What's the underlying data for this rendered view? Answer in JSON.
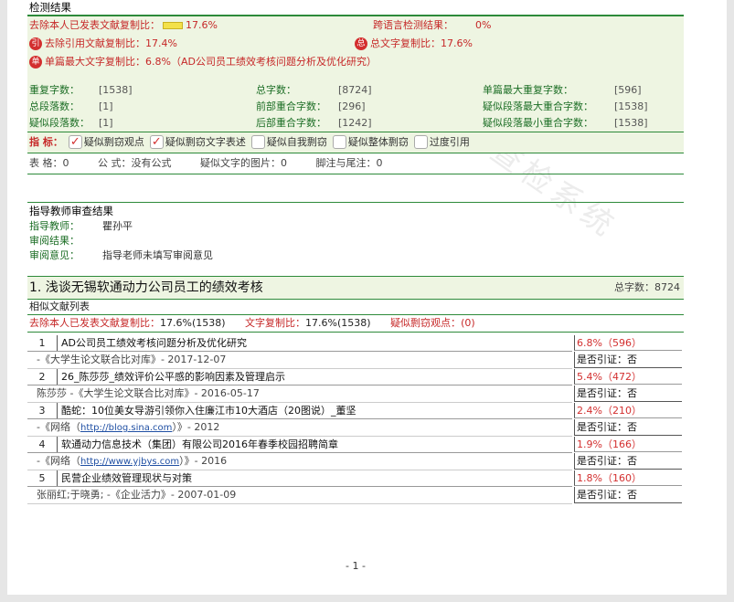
{
  "detection": {
    "section_title": "检测结果",
    "excl_label": "去除本人已发表文献复制比：",
    "excl_value": "17.6%",
    "cross_label": "跨语言检测结果：",
    "cross_value": "0%",
    "cite_badge": "引",
    "cite_label": "去除引用文献复制比：",
    "cite_value": "17.4%",
    "total_badge": "总",
    "total_label": "总文字复制比：",
    "total_value": "17.6%",
    "single_badge": "单",
    "single_label": "单篇最大文字复制比：",
    "single_value": "6.8%（AD公司员工绩效考核问题分析及优化研究）"
  },
  "stats": [
    [
      {
        "label": "重复字数：",
        "value": "[1538]"
      },
      {
        "label": "总字数：",
        "value": "[8724]"
      },
      {
        "label": "单篇最大重复字数：",
        "value": "[596]"
      }
    ],
    [
      {
        "label": "总段落数：",
        "value": "[1]"
      },
      {
        "label": "前部重合字数：",
        "value": "[296]"
      },
      {
        "label": "疑似段落最大重合字数：",
        "value": "[1538]"
      }
    ],
    [
      {
        "label": "疑似段落数：",
        "value": "[1]"
      },
      {
        "label": "后部重合字数：",
        "value": "[1242]"
      },
      {
        "label": "疑似段落最小重合字数：",
        "value": "[1538]"
      }
    ]
  ],
  "indicators": {
    "label": "指  标：",
    "items": [
      {
        "text": "疑似剽窃观点",
        "checked": true
      },
      {
        "text": "疑似剽窃文字表述",
        "checked": true
      },
      {
        "text": "疑似自我剽窃",
        "checked": false
      },
      {
        "text": "疑似整体剽窃",
        "checked": false
      },
      {
        "text": "过度引用",
        "checked": false
      }
    ]
  },
  "table_info": {
    "tables": "表  格：0",
    "formula": "公  式：没有公式",
    "images": "疑似文字的图片：0",
    "notes": "脚注与尾注：0"
  },
  "teacher": {
    "section_title": "指导教师审查结果",
    "name_label": "指导教师：",
    "name_value": "瞿孙平",
    "result_label": "审阅结果：",
    "result_value": "",
    "opinion_label": "审阅意见：",
    "opinion_value": "指导老师未填写审阅意见"
  },
  "document": {
    "title": "1. 浅谈无锡软通动力公司员工的绩效考核",
    "total_label": "总字数：",
    "total_value": "8724",
    "list_title": "相似文献列表",
    "sum_excl_label": "去除本人已发表文献复制比：",
    "sum_excl_value": "17.6%(1538)",
    "sum_copy_label": "文字复制比：",
    "sum_copy_value": "17.6%(1538)",
    "sum_plag_label": "疑似剽窃观点：",
    "sum_plag_value": "(0)"
  },
  "items": [
    {
      "num": "1",
      "title": "AD公司员工绩效考核问题分析及优化研究",
      "src_pre": "-《大学生论文联合比对库》- 2017-12-07",
      "link": "",
      "src_post": "",
      "pct": "6.8%（596）",
      "cite": "是否引证：否"
    },
    {
      "num": "2",
      "title": "26_陈莎莎_绩效评价公平感的影响因素及管理启示",
      "src_pre": "陈莎莎 -《大学生论文联合比对库》- 2016-05-17",
      "link": "",
      "src_post": "",
      "pct": "5.4%（472）",
      "cite": "是否引证：否"
    },
    {
      "num": "3",
      "title": "酷蛇：10位美女导游引领你入住廉江市10大酒店（20图说）_董坚",
      "src_pre": "-《网络（",
      "link": "http://blog.sina.com",
      "src_post": "）》- 2012",
      "pct": "2.4%（210）",
      "cite": "是否引证：否"
    },
    {
      "num": "4",
      "title": "软通动力信息技术（集团）有限公司2016年春季校园招聘简章",
      "src_pre": "-《网络（",
      "link": "http://www.yjbys.com",
      "src_post": "）》- 2016",
      "pct": "1.9%（166）",
      "cite": "是否引证：否"
    },
    {
      "num": "5",
      "title": "民营企业绩效管理现状与对策",
      "src_pre": "张丽红;于晓勇; -《企业活力》- 2007-01-09",
      "link": "",
      "src_post": "",
      "pct": "1.8%（160）",
      "cite": "是否引证：否"
    }
  ],
  "page_number": "- 1 -",
  "watermark": "查检系统"
}
